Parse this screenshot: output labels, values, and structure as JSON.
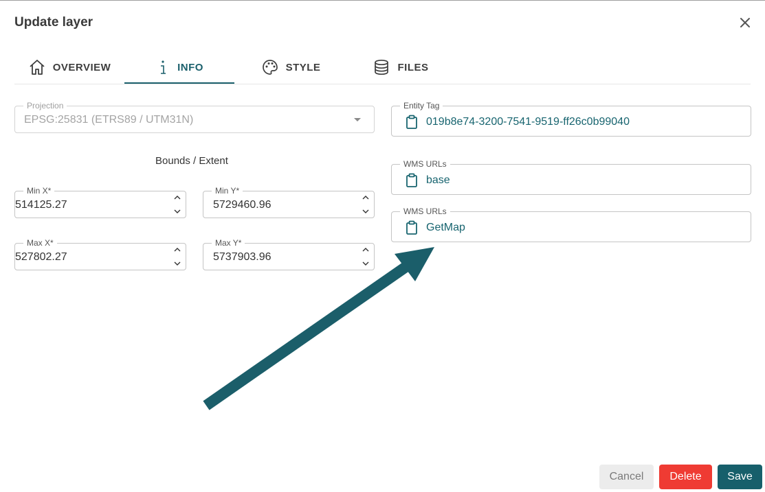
{
  "dialog": {
    "title": "Update layer"
  },
  "tabs": [
    {
      "label": "OVERVIEW",
      "icon": "home-icon"
    },
    {
      "label": "INFO",
      "icon": "info-icon",
      "active": true
    },
    {
      "label": "STYLE",
      "icon": "palette-icon"
    },
    {
      "label": "FILES",
      "icon": "database-icon"
    }
  ],
  "projection": {
    "label": "Projection",
    "value": "EPSG:25831 (ETRS89 / UTM31N)"
  },
  "bounds": {
    "heading": "Bounds / Extent",
    "min_x": {
      "label": "Min X*",
      "value": "514125.27"
    },
    "min_y": {
      "label": "Min Y*",
      "value": "5729460.96"
    },
    "max_x": {
      "label": "Max X*",
      "value": "527802.27"
    },
    "max_y": {
      "label": "Max Y*",
      "value": "5737903.96"
    }
  },
  "entity_tag": {
    "label": "Entity Tag",
    "value": "019b8e74-3200-7541-9519-ff26c0b99040"
  },
  "wms_urls": [
    {
      "label": "WMS URLs",
      "value": "base"
    },
    {
      "label": "WMS URLs",
      "value": "GetMap"
    }
  ],
  "buttons": {
    "cancel": "Cancel",
    "delete": "Delete",
    "save": "Save"
  },
  "colors": {
    "accent": "#175f6b",
    "danger": "#ef3b33",
    "annotation_arrow": "#1b5e6a"
  }
}
